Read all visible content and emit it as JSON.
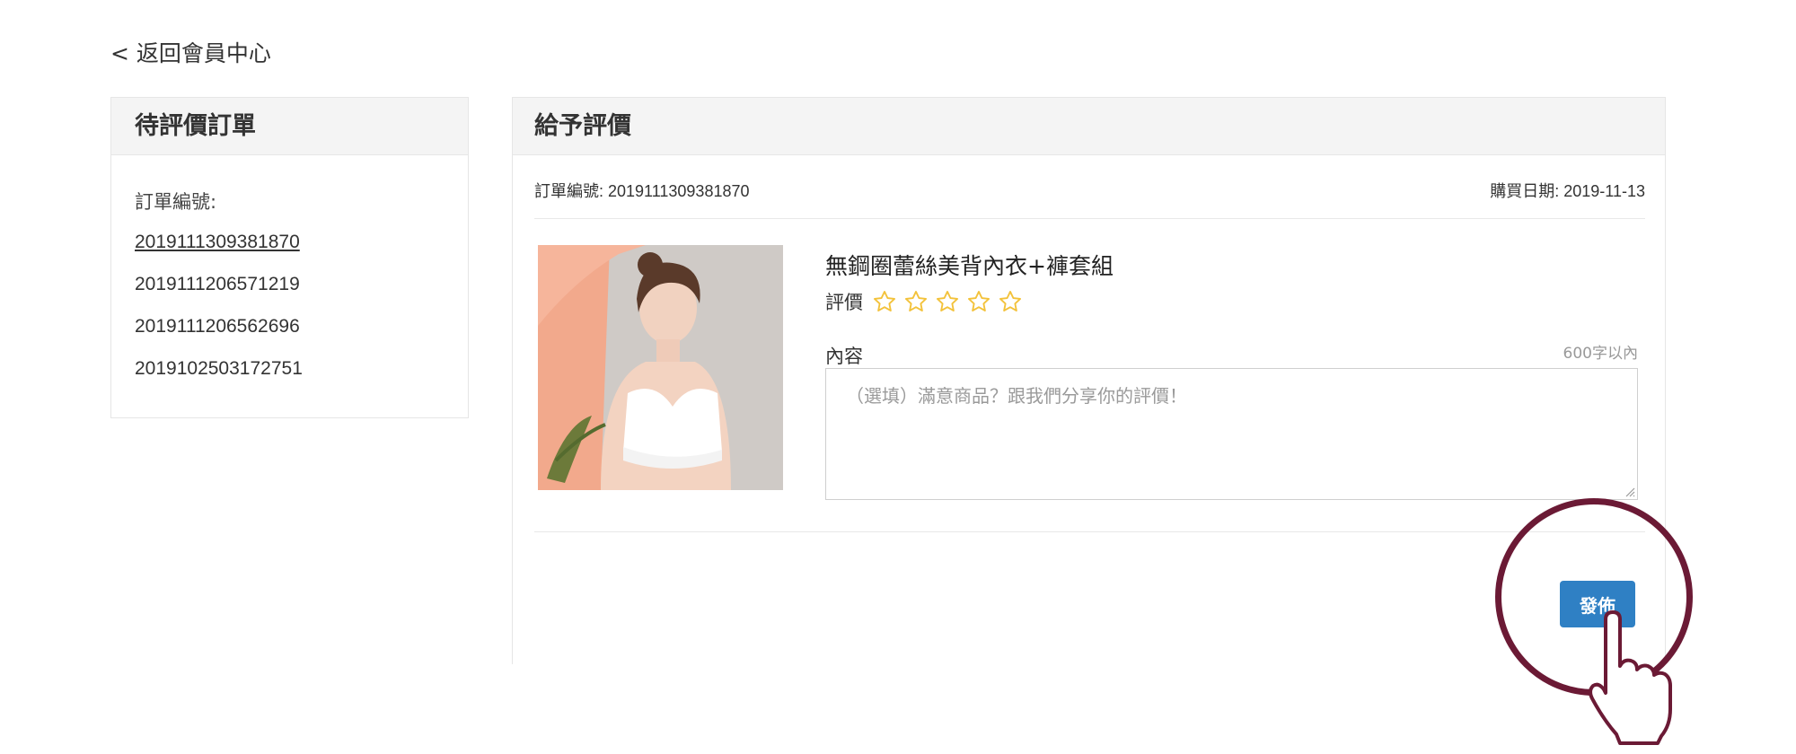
{
  "nav": {
    "back_label": "< 返回會員中心"
  },
  "pending": {
    "title": "待評價訂單",
    "order_label": "訂單編號:",
    "orders": [
      "2019111309381870",
      "2019111206571219",
      "2019111206562696",
      "2019102503172751"
    ]
  },
  "review": {
    "title": "給予評價",
    "order_no": "訂單編號: 2019111309381870",
    "purchase_date": "購買日期: 2019-11-13",
    "product_name": "無鋼圈蕾絲美背內衣+褲套組",
    "rating_label": "評價",
    "rating": 0,
    "rating_max": 5,
    "content_label": "內容",
    "char_limit": "600字以內",
    "placeholder": "（選填）滿意商品？跟我們分享你的評價！",
    "publish_label": "發佈"
  },
  "colors": {
    "accent": "#2f80c4",
    "star": "#f3c23a",
    "highlight": "#6b1a35"
  },
  "icons": {
    "star": "star-outline-icon",
    "pointer": "hand-pointer-icon"
  }
}
